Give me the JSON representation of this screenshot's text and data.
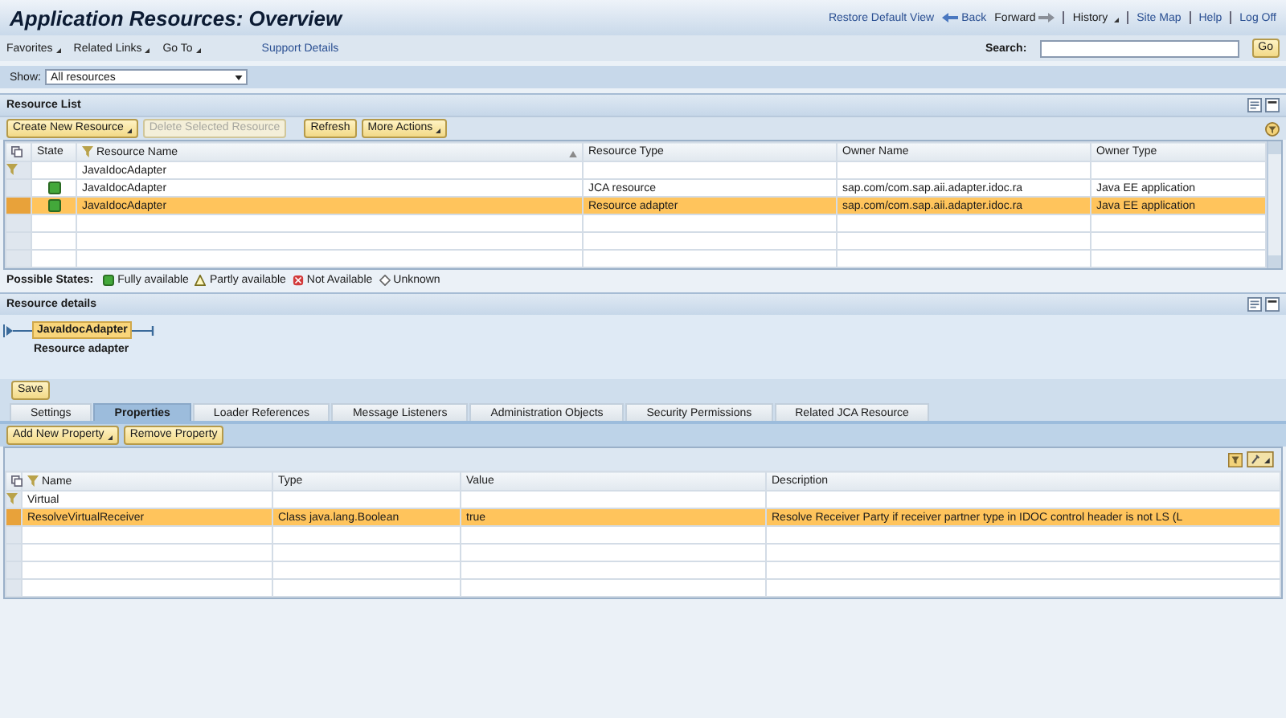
{
  "header": {
    "title": "Application Resources: Overview",
    "links": [
      {
        "label": "Restore Default View",
        "kind": "link"
      },
      {
        "label": "Back",
        "kind": "back"
      },
      {
        "label": "Forward",
        "kind": "forward"
      },
      {
        "label": "History",
        "kind": "menu"
      },
      {
        "label": "Site Map",
        "kind": "link"
      },
      {
        "label": "Help",
        "kind": "link"
      },
      {
        "label": "Log Off",
        "kind": "link"
      }
    ]
  },
  "menu_bar": {
    "items": [
      {
        "label": "Favorites",
        "menu": true
      },
      {
        "label": "Related Links",
        "menu": true
      },
      {
        "label": "Go To",
        "menu": true
      },
      {
        "label": "Support Details",
        "menu": false
      }
    ],
    "search": {
      "label": "Search:",
      "button": "Go"
    }
  },
  "show_filter": {
    "label": "Show:",
    "value": "All resources"
  },
  "resource_list": {
    "title": "Resource List",
    "buttons": [
      {
        "label": "Create New Resource",
        "menu": true,
        "disabled": false
      },
      {
        "label": "Delete Selected Resource",
        "menu": false,
        "disabled": true
      },
      {
        "label": "Refresh",
        "menu": false,
        "disabled": false
      },
      {
        "label": "More Actions",
        "menu": true,
        "disabled": false
      }
    ],
    "columns": [
      "State",
      "Resource Name",
      "Resource Type",
      "Owner Name",
      "Owner Type"
    ],
    "filter": "JavaIdocAdapter",
    "rows": [
      {
        "color": "#43a83a",
        "name": "JavaIdocAdapter",
        "type": "JCA resource",
        "owner_name": "sap.com/com.sap.aii.adapter.idoc.ra",
        "owner_type": "Java EE application",
        "selected": false
      },
      {
        "color": "#43a83a",
        "name": "JavaIdocAdapter",
        "type": "Resource adapter",
        "owner_name": "sap.com/com.sap.aii.adapter.idoc.ra",
        "owner_type": "Java EE application",
        "selected": true
      }
    ],
    "legend": {
      "label": "Possible States:",
      "items": [
        {
          "kind": "fully",
          "label": "Fully available"
        },
        {
          "kind": "partly",
          "label": "Partly available"
        },
        {
          "kind": "not",
          "label": "Not Available"
        },
        {
          "kind": "unknown",
          "label": "Unknown"
        }
      ]
    }
  },
  "resource_details": {
    "title": "Resource details",
    "path": [
      {
        "label": "JavaIdocAdapter",
        "sublabel": "Resource adapter"
      }
    ],
    "save": "Save",
    "tabs": [
      {
        "label": "Settings",
        "selected": false
      },
      {
        "label": "Properties",
        "selected": true
      },
      {
        "label": "Loader References",
        "selected": false
      },
      {
        "label": "Message Listeners",
        "selected": false
      },
      {
        "label": "Administration Objects",
        "selected": false
      },
      {
        "label": "Security Permissions",
        "selected": false
      },
      {
        "label": "Related JCA Resource",
        "selected": false
      }
    ],
    "buttons": [
      {
        "label": "Add New Property",
        "menu": true
      },
      {
        "label": "Remove Property",
        "menu": false
      }
    ],
    "columns": [
      "Name",
      "Type",
      "Value",
      "Description"
    ],
    "filter": "Virtual",
    "rows": [
      {
        "name": "ResolveVirtualReceiver",
        "type": "Class java.lang.Boolean",
        "value": "true",
        "description": "Resolve Receiver Party if receiver partner type in IDOC control header is not LS (L",
        "selected": true
      }
    ]
  }
}
